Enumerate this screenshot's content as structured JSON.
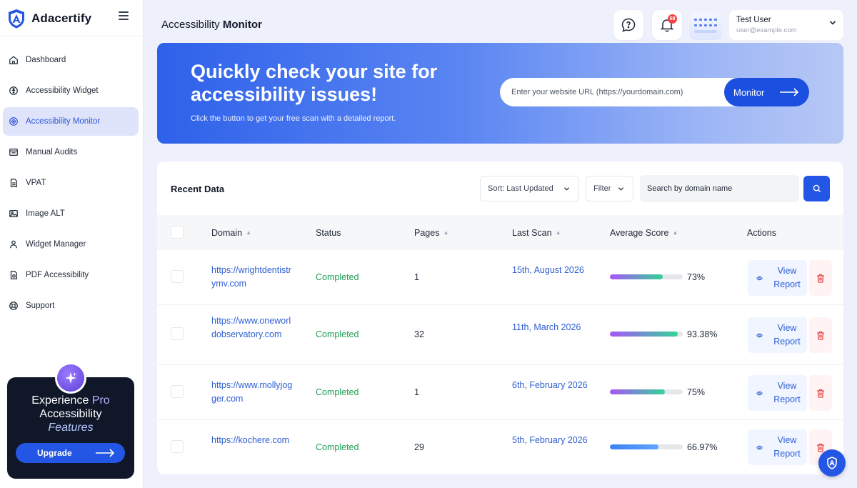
{
  "brand": {
    "name": "Adacertify"
  },
  "sidebar": {
    "items": [
      {
        "label": "Dashboard",
        "icon": "home-icon",
        "active": false
      },
      {
        "label": "Accessibility Widget",
        "icon": "widget-icon",
        "active": false
      },
      {
        "label": "Accessibility Monitor",
        "icon": "monitor-icon",
        "active": true
      },
      {
        "label": "Manual Audits",
        "icon": "audit-icon",
        "active": false
      },
      {
        "label": "VPAT",
        "icon": "document-icon",
        "active": false
      },
      {
        "label": "Image ALT",
        "icon": "image-icon",
        "active": false
      },
      {
        "label": "Widget Manager",
        "icon": "users-icon",
        "active": false
      },
      {
        "label": "PDF Accessibility",
        "icon": "pdf-icon",
        "active": false
      },
      {
        "label": "Support",
        "icon": "support-icon",
        "active": false
      }
    ],
    "promo": {
      "line1": "Experience ",
      "pro": "Pro",
      "line2": "Accessibility",
      "line3": "Features",
      "button": "Upgrade"
    }
  },
  "header": {
    "title_light": "Accessibility ",
    "title_bold": "Monitor",
    "notification_count": "68",
    "user": {
      "name": "Test User",
      "email": "user@example.com"
    }
  },
  "hero": {
    "title": "Quickly check your site for accessibility issues!",
    "subtitle": "Click the button to get your free scan with a detailed report.",
    "url_placeholder": "Enter your website URL (https://yourdomain.com)",
    "button": "Monitor"
  },
  "table": {
    "title": "Recent Data",
    "sort_label": "Sort: Last Updated",
    "filter_label": "Filter",
    "search_placeholder": "Search by domain name",
    "columns": {
      "domain": "Domain",
      "status": "Status",
      "pages": "Pages",
      "last_scan": "Last Scan",
      "score": "Average Score",
      "actions": "Actions"
    },
    "view_label": "View Report",
    "rows": [
      {
        "domain": "https://wrightdentistrymv.com",
        "status": "Completed",
        "pages": "1",
        "last_scan": "15th, August 2026",
        "score": "73%",
        "score_value": 73
      },
      {
        "domain": "https://www.oneworldobservatory.com",
        "status": "Completed",
        "pages": "32",
        "last_scan": "11th, March 2026",
        "score": "93.38%",
        "score_value": 93.38
      },
      {
        "domain": "https://www.mollyjogger.com",
        "status": "Completed",
        "pages": "1",
        "last_scan": "6th, February 2026",
        "score": "75%",
        "score_value": 75
      },
      {
        "domain": "https://kochere.com",
        "status": "Completed",
        "pages": "29",
        "last_scan": "5th, February 2026",
        "score": "66.97%",
        "score_value": 66.97
      }
    ]
  },
  "colors": {
    "accent": "#2456e5",
    "link": "#2f5fd3",
    "success": "#1f9d55",
    "danger": "#ef4444",
    "sidebar_active_bg": "#dfe4fb"
  }
}
